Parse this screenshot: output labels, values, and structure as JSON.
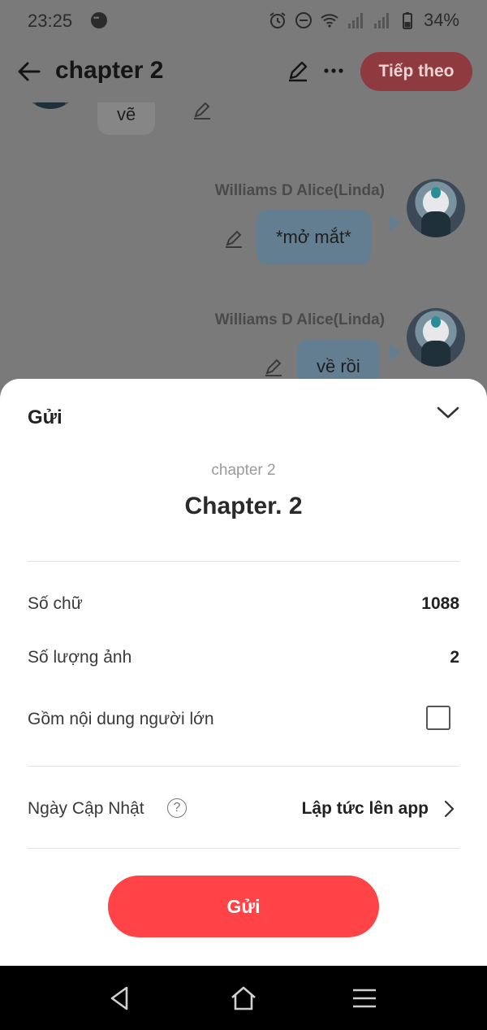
{
  "status_bar": {
    "time": "23:25",
    "battery": "34%",
    "icons": [
      "messenger-icon",
      "alarm-icon",
      "do-not-disturb-icon",
      "wifi-icon",
      "signal-icon",
      "signal-icon",
      "battery-icon"
    ]
  },
  "header": {
    "title": "chapter 2",
    "next_label": "Tiếp theo"
  },
  "chat": {
    "partial_bubble": "vẽ",
    "messages": [
      {
        "sender": "Williams D Alice(Linda)",
        "text": "*mở mắt*"
      },
      {
        "sender": "Williams D Alice(Linda)",
        "text": "về rồi"
      }
    ]
  },
  "sheet": {
    "title": "Gửi",
    "chapter_name": "chapter 2",
    "chapter_title": "Chapter. 2",
    "rows": {
      "word_count_label": "Số chữ",
      "word_count_value": "1088",
      "image_count_label": "Số lượng ảnh",
      "image_count_value": "2",
      "adult_label": "Gồm nội dung người lớn",
      "adult_checked": false,
      "update_label": "Ngày Cập Nhật",
      "help_glyph": "?",
      "update_value": "Lập tức lên app"
    },
    "submit_label": "Gửi"
  },
  "colors": {
    "accent": "#ff4346",
    "overlay": "#7a7a7a",
    "bubble": "#637e91"
  }
}
